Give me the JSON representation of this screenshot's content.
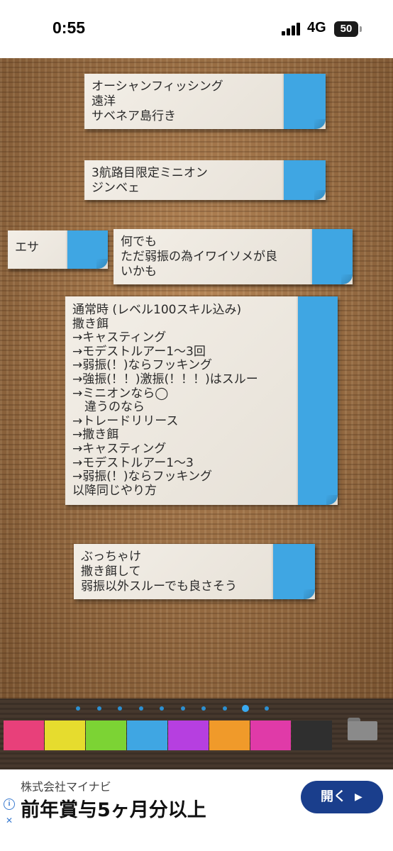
{
  "status_bar": {
    "time": "0:55",
    "network": "4G",
    "battery": "50"
  },
  "board": {
    "notes": [
      {
        "text": "オーシャンフィッシング\n遠洋\nサベネア島行き"
      },
      {
        "text": "3航路目限定ミニオン\nジンベェ"
      },
      {
        "text": "エサ"
      },
      {
        "text": "何でも\nただ弱振の為イワイソメが良\nいかも"
      },
      {
        "text": "通常時 (レベル100スキル込み)\n撒き餌\n→キャスティング\n→モデストルアー1〜3回\n→弱振(！)ならフッキング\n→強振(！！)激振(！！！)はスルー\n→ミニオンなら◯\n　違うのなら\n→トレードリリース\n→撒き餌\n→キャスティング\n→モデストルアー1〜3\n→弱振(！)ならフッキング\n以降同じやり方"
      },
      {
        "text": "ぶっちゃけ\n撒き餌して\n弱振以外スルーでも良さそう"
      }
    ],
    "note_tab_color": "#3fa6e3"
  },
  "toolbar": {
    "page_count": 10,
    "active_page": 9,
    "colors": [
      "#e8407a",
      "#e6dc2e",
      "#7cd334",
      "#3fa6e3",
      "#b63fe0",
      "#f09a2a",
      "#e03aa8",
      "#2f2f2f"
    ]
  },
  "ad": {
    "company": "株式会社マイナビ",
    "headline": "前年賞与5ヶ月分以上",
    "button_label": "開く",
    "button_arrow": "▶",
    "info_icon": "i",
    "close_icon": "✕"
  }
}
